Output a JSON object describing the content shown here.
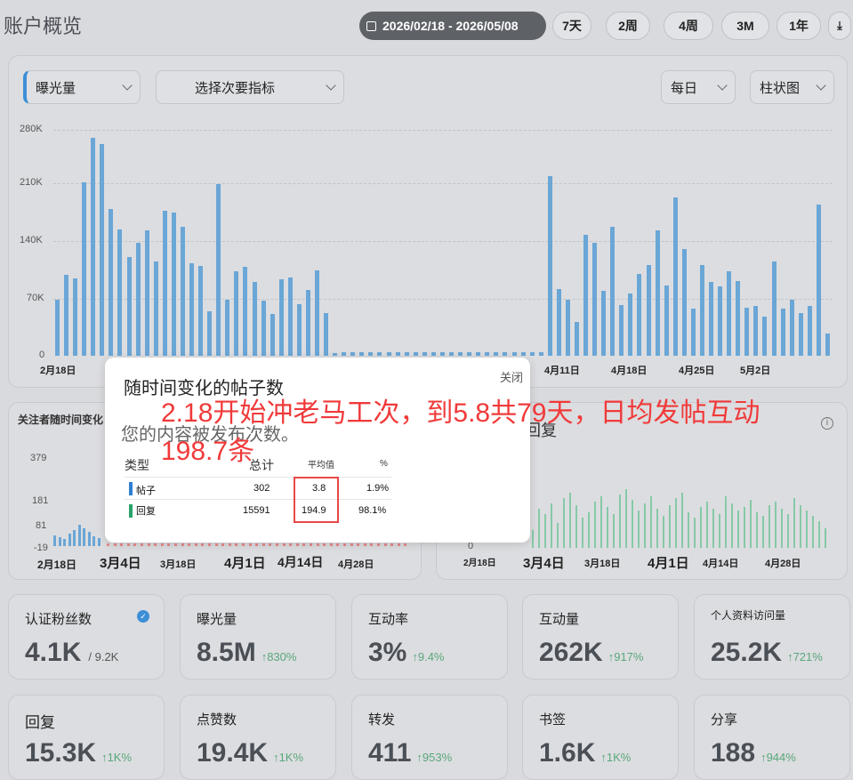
{
  "header": {
    "title": "账户概览",
    "date_range": "2026/02/18 - 2026/05/08",
    "ranges": [
      "7天",
      "2周",
      "4周",
      "3M",
      "1年"
    ]
  },
  "main_chart": {
    "primary_metric": "曝光量",
    "secondary_metric": "选择次要指标",
    "interval": "每日",
    "chart_type": "柱状图",
    "y_ticks": [
      "280K",
      "210K",
      "140K",
      "70K",
      "0"
    ],
    "x_labels": [
      "2月18日",
      "4月11日",
      "4月18日",
      "4月25日",
      "5月2日"
    ]
  },
  "chart_data": {
    "type": "bar",
    "ylim": [
      0,
      280000
    ],
    "values": [
      70000,
      100000,
      96000,
      215000,
      270000,
      262000,
      182000,
      157000,
      122000,
      140000,
      155000,
      117000,
      180000,
      177000,
      160000,
      115000,
      111000,
      55000,
      213000,
      70000,
      105000,
      110000,
      92000,
      68000,
      52000,
      95000,
      97000,
      64000,
      82000,
      106000,
      53000,
      3000,
      4000,
      4000,
      4000,
      4000,
      4000,
      4000,
      4000,
      4000,
      4000,
      4000,
      4000,
      4000,
      4000,
      4000,
      4000,
      4000,
      4000,
      4000,
      4000,
      4000,
      4000,
      4000,
      4000,
      223000,
      83000,
      70000,
      42000,
      150000,
      140000,
      80000,
      160000,
      63000,
      77000,
      101000,
      112000,
      156000,
      87000,
      196000,
      132000,
      58000,
      112000,
      92000,
      86000,
      105000,
      93000,
      59000,
      62000,
      49000,
      117000,
      58000,
      69000,
      53000,
      62000,
      187000,
      28000
    ]
  },
  "left_panel": {
    "title": "关注者随时间变化",
    "y_ticks": [
      "379",
      "181",
      "81",
      "-19"
    ],
    "x_labels": [
      "2月18日",
      "3月4日",
      "3月18日",
      "4月1日",
      "4月14日",
      "4月28日"
    ]
  },
  "right_panel": {
    "title": "回复",
    "y_zero": "0",
    "x_labels": [
      "2月18日",
      "3月4日",
      "3月18日",
      "4月1日",
      "4月14日",
      "4月28日"
    ]
  },
  "popup": {
    "title": "随时间变化的帖子数",
    "close": "关闭",
    "subtitle": "您的内容被发布次数。",
    "columns": [
      "类型",
      "总计",
      "平均值",
      "%"
    ],
    "rows": [
      {
        "type": "帖子",
        "total": "302",
        "avg": "3.8",
        "pct": "1.9%",
        "color": "#2e7fd2"
      },
      {
        "type": "回复",
        "total": "15591",
        "avg": "194.9",
        "pct": "98.1%",
        "color": "#27a36a"
      }
    ]
  },
  "annotation": {
    "line1": "2.18开始冲老马工次，到5.8共79天，日均发帖互动",
    "line2": "198.7条"
  },
  "stats": [
    {
      "label": "认证粉丝数",
      "value": "4.1K",
      "sub": "/ 9.2K",
      "change": ""
    },
    {
      "label": "曝光量",
      "value": "8.5M",
      "sub": "",
      "change": "↑830%"
    },
    {
      "label": "互动率",
      "value": "3%",
      "sub": "",
      "change": "↑9.4%"
    },
    {
      "label": "互动量",
      "value": "262K",
      "sub": "",
      "change": "↑917%"
    },
    {
      "label": "个人资料访问量",
      "value": "25.2K",
      "sub": "",
      "change": "↑721%"
    },
    {
      "label": "回复",
      "value": "15.3K",
      "sub": "",
      "change": "↑1K%"
    },
    {
      "label": "点赞数",
      "value": "19.4K",
      "sub": "",
      "change": "↑1K%"
    },
    {
      "label": "转发",
      "value": "411",
      "sub": "",
      "change": "↑953%"
    },
    {
      "label": "书签",
      "value": "1.6K",
      "sub": "",
      "change": "↑1K%"
    },
    {
      "label": "分享",
      "value": "188",
      "sub": "",
      "change": "↑944%"
    }
  ]
}
